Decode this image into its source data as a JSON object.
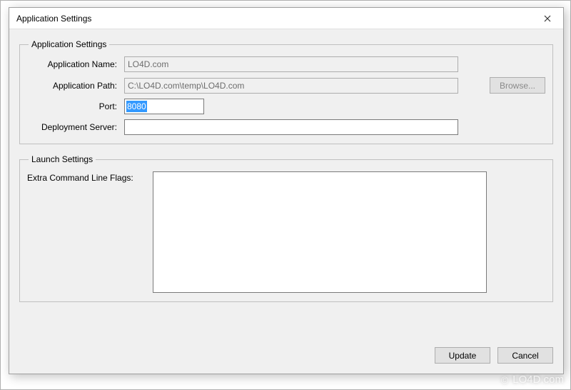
{
  "window": {
    "title": "Application Settings"
  },
  "groups": {
    "app_settings": {
      "legend": "Application Settings",
      "app_name_label": "Application Name:",
      "app_name_value": "LO4D.com",
      "app_path_label": "Application Path:",
      "app_path_value": "C:\\LO4D.com\\temp\\LO4D.com",
      "browse_label": "Browse...",
      "port_label": "Port:",
      "port_value": "8080",
      "deploy_label": "Deployment Server:",
      "deploy_value": ""
    },
    "launch_settings": {
      "legend": "Launch Settings",
      "extra_flags_label": "Extra Command Line Flags:",
      "extra_flags_value": ""
    }
  },
  "footer": {
    "update_label": "Update",
    "cancel_label": "Cancel"
  },
  "watermark": {
    "text": "LO4D.com",
    "copyright_symbol": "©"
  }
}
